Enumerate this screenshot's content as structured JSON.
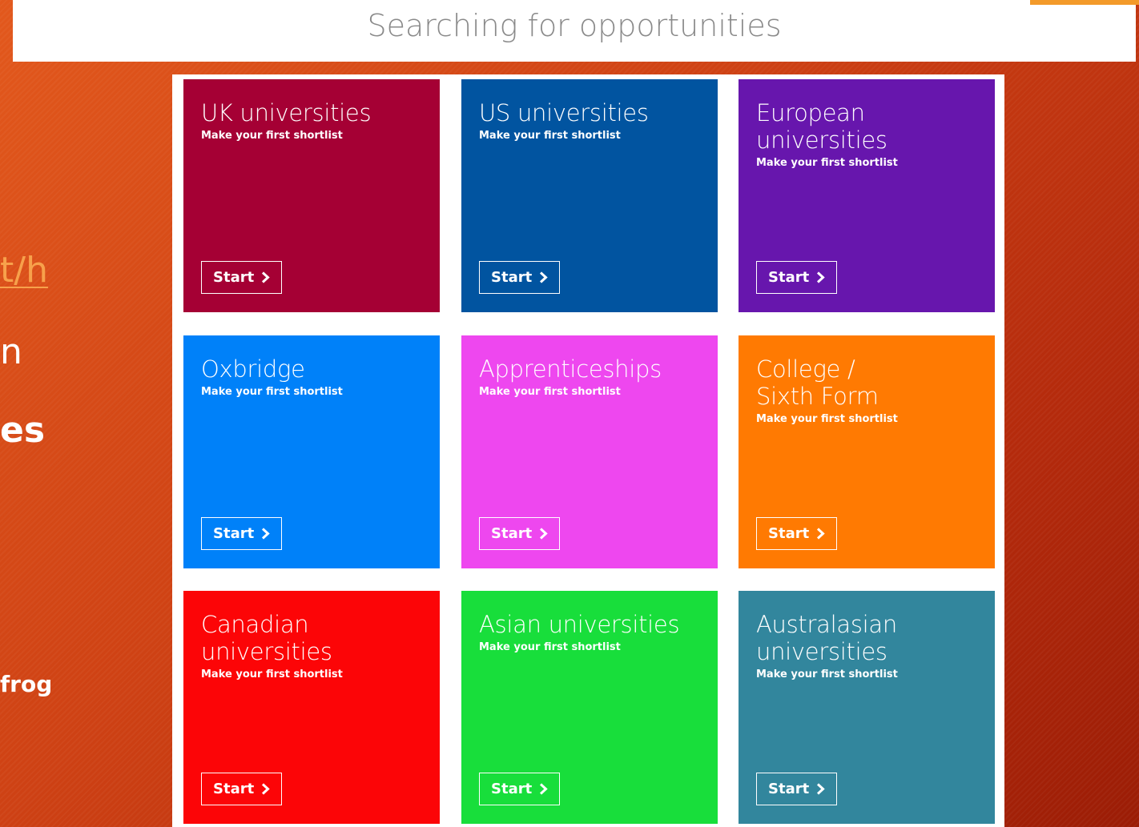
{
  "header": {
    "title": "Searching for opportunities"
  },
  "background_slide": {
    "link_fragment": "t/h",
    "fragment_n": "n",
    "fragment_es": "es",
    "fragment_frog": "frog"
  },
  "tiles": [
    {
      "title": "UK universities",
      "subtitle": "Make your first shortlist",
      "button": "Start",
      "color": "#a50034"
    },
    {
      "title": "US universities",
      "subtitle": "Make your first shortlist",
      "button": "Start",
      "color": "#0154a0"
    },
    {
      "title": "European universities",
      "subtitle": "Make your first shortlist",
      "button": "Start",
      "color": "#6716ad"
    },
    {
      "title": "Oxbridge",
      "subtitle": "Make your first shortlist",
      "button": "Start",
      "color": "#0081f9"
    },
    {
      "title": "Apprenticeships",
      "subtitle": "Make your first shortlist",
      "button": "Start",
      "color": "#ee47ef"
    },
    {
      "title": "College / Sixth Form",
      "subtitle": "Make your first shortlist",
      "button": "Start",
      "color": "#ff7a02"
    },
    {
      "title": "Canadian universities",
      "subtitle": "Make your first shortlist",
      "button": "Start",
      "color": "#fc0507"
    },
    {
      "title": "Asian universities",
      "subtitle": "Make your first shortlist",
      "button": "Start",
      "color": "#18de3b"
    },
    {
      "title": "Australasian universities",
      "subtitle": "Make your first shortlist",
      "button": "Start",
      "color": "#32869d"
    }
  ],
  "icons": {
    "start_button_icon": "chevron-right-icon"
  }
}
